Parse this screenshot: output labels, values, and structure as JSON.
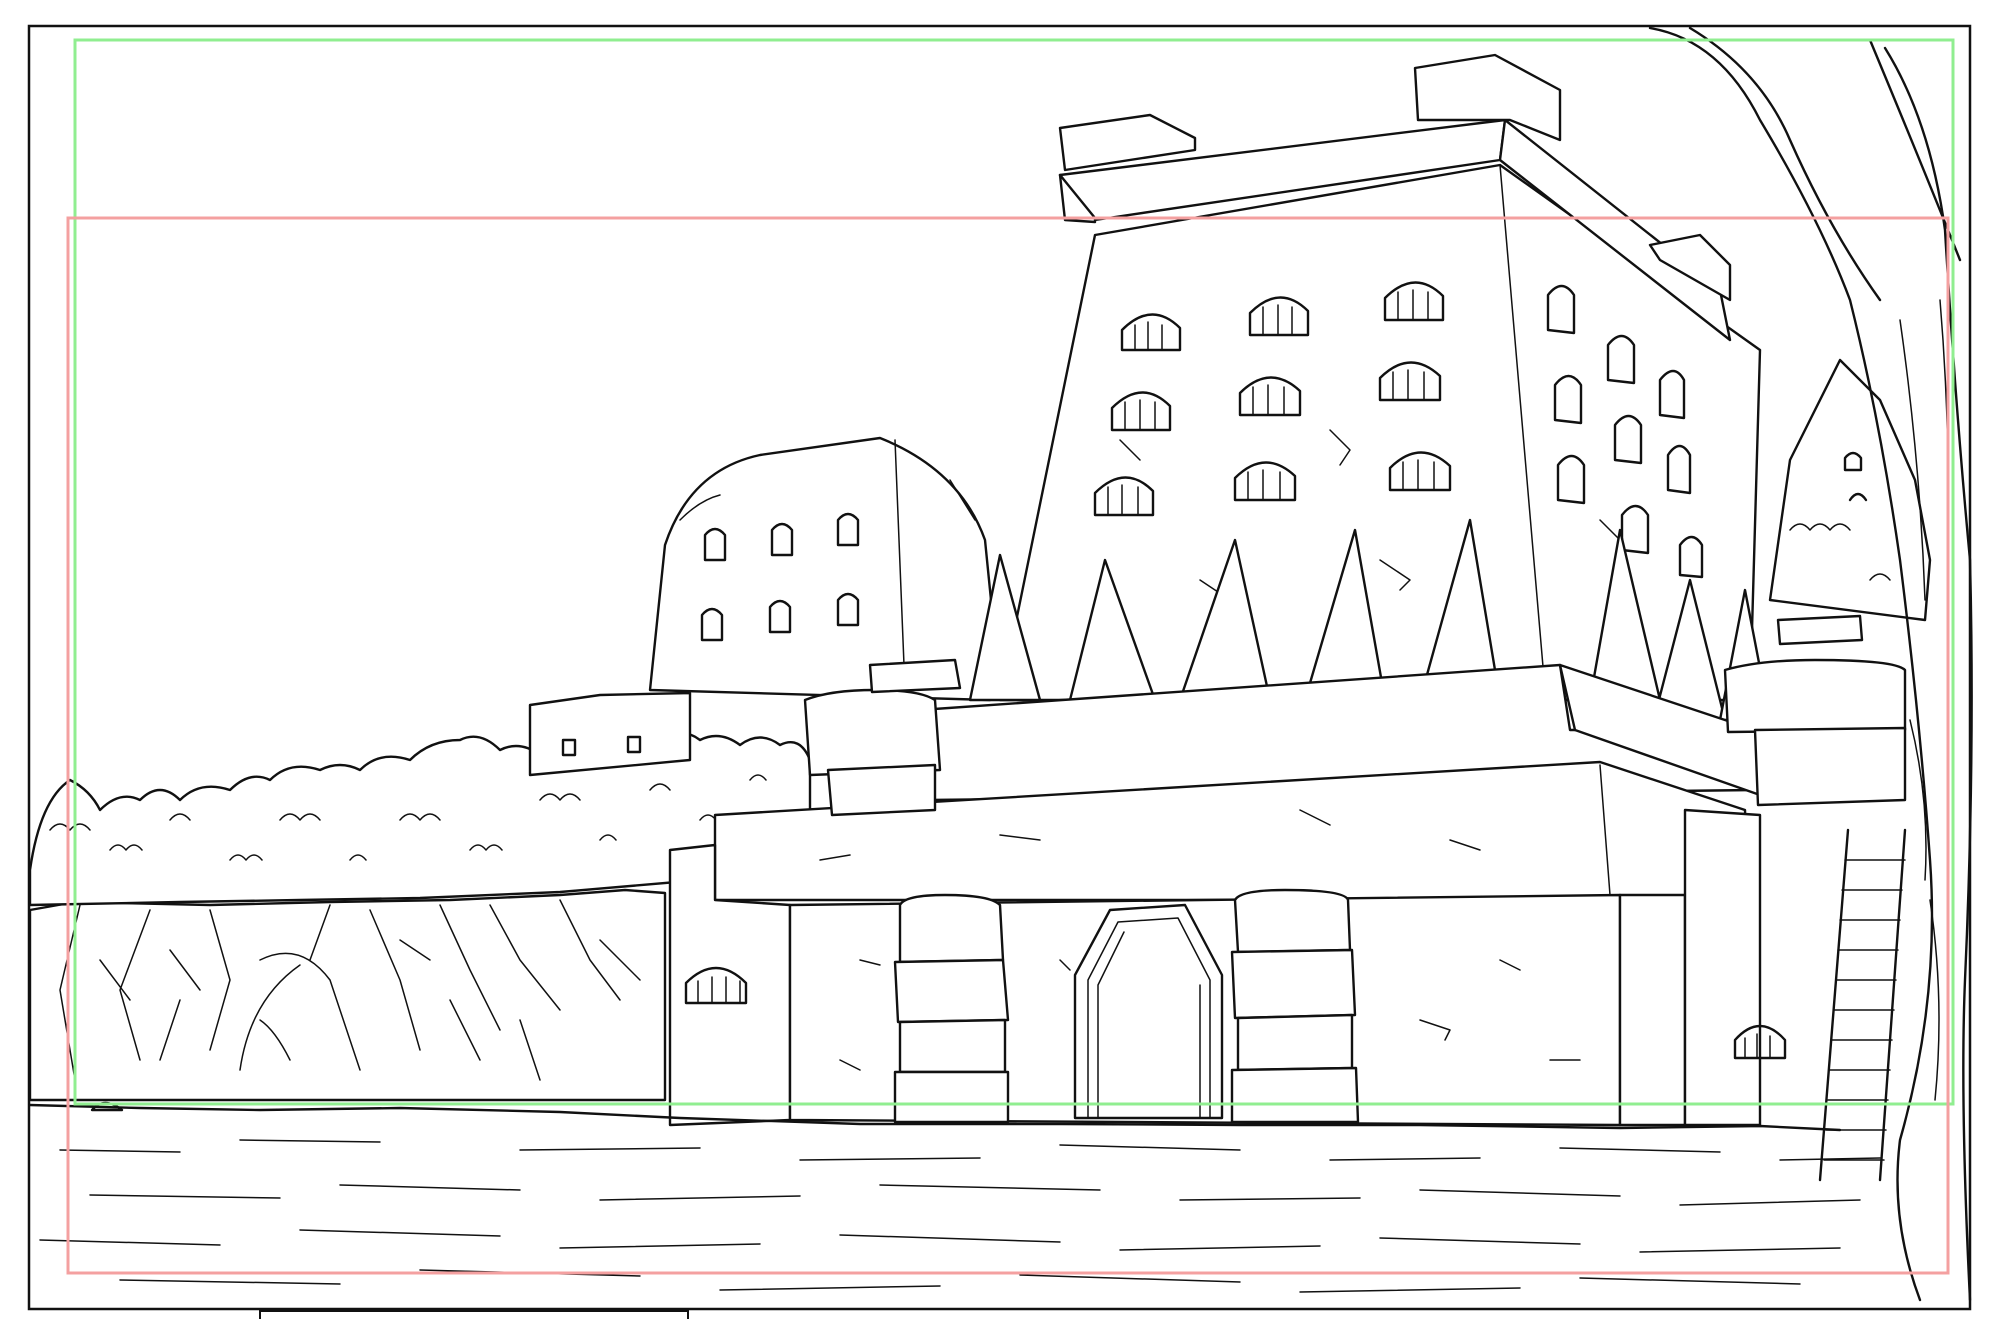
{
  "colors": {
    "background": "#ffffff",
    "ink": "#111111",
    "safe_frame_green": "#90ee90",
    "safe_frame_red": "#f4a0a0"
  }
}
